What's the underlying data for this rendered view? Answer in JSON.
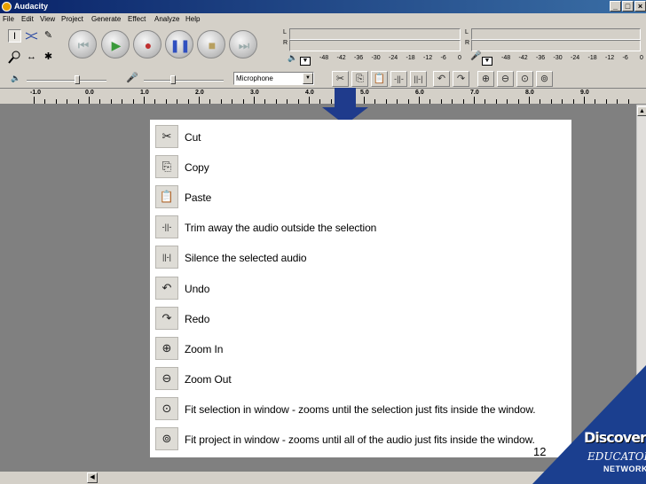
{
  "window": {
    "title": "Audacity",
    "controls": [
      "_",
      "□",
      "×"
    ]
  },
  "menubar": [
    "File",
    "Edit",
    "View",
    "Project",
    "Generate",
    "Effect",
    "Analyze",
    "Help"
  ],
  "meters": {
    "left_label": "L",
    "right_label": "R",
    "scale": [
      "-48",
      "-42",
      "-36",
      "-30",
      "-24",
      "-18",
      "-12",
      "-6",
      "0"
    ]
  },
  "mixer": {
    "input_source": "Microphone"
  },
  "ruler": {
    "labels": [
      "-1.0",
      "0.0",
      "1.0",
      "2.0",
      "3.0",
      "4.0",
      "5.0",
      "6.0",
      "7.0",
      "8.0",
      "9.0"
    ]
  },
  "legend": [
    {
      "icon": "scissors-icon",
      "label": "Cut"
    },
    {
      "icon": "copy-icon",
      "label": "Copy"
    },
    {
      "icon": "paste-icon",
      "label": "Paste"
    },
    {
      "icon": "trim-icon",
      "label": "Trim away the audio outside the selection"
    },
    {
      "icon": "silence-icon",
      "label": "Silence the selected audio"
    },
    {
      "icon": "undo-icon",
      "label": "Undo"
    },
    {
      "icon": "redo-icon",
      "label": "Redo"
    },
    {
      "icon": "zoom-in-icon",
      "label": "Zoom In"
    },
    {
      "icon": "zoom-out-icon",
      "label": "Zoom Out"
    },
    {
      "icon": "fit-selection-icon",
      "label": "Fit selection in window - zooms until the selection just fits inside the window."
    },
    {
      "icon": "fit-project-icon",
      "label": "Fit project in window - zooms until all of the audio just fits inside the window."
    }
  ],
  "page_number": "12",
  "branding": {
    "line1": "Discovery",
    "line2": "EDUCATOR",
    "line3": "NETWORK"
  },
  "colors": {
    "titlebar": "#0a246a",
    "chrome": "#d4d0c8",
    "workspace": "#808080",
    "pointer": "#1f3b8c",
    "brand": "#1b3f8f"
  }
}
